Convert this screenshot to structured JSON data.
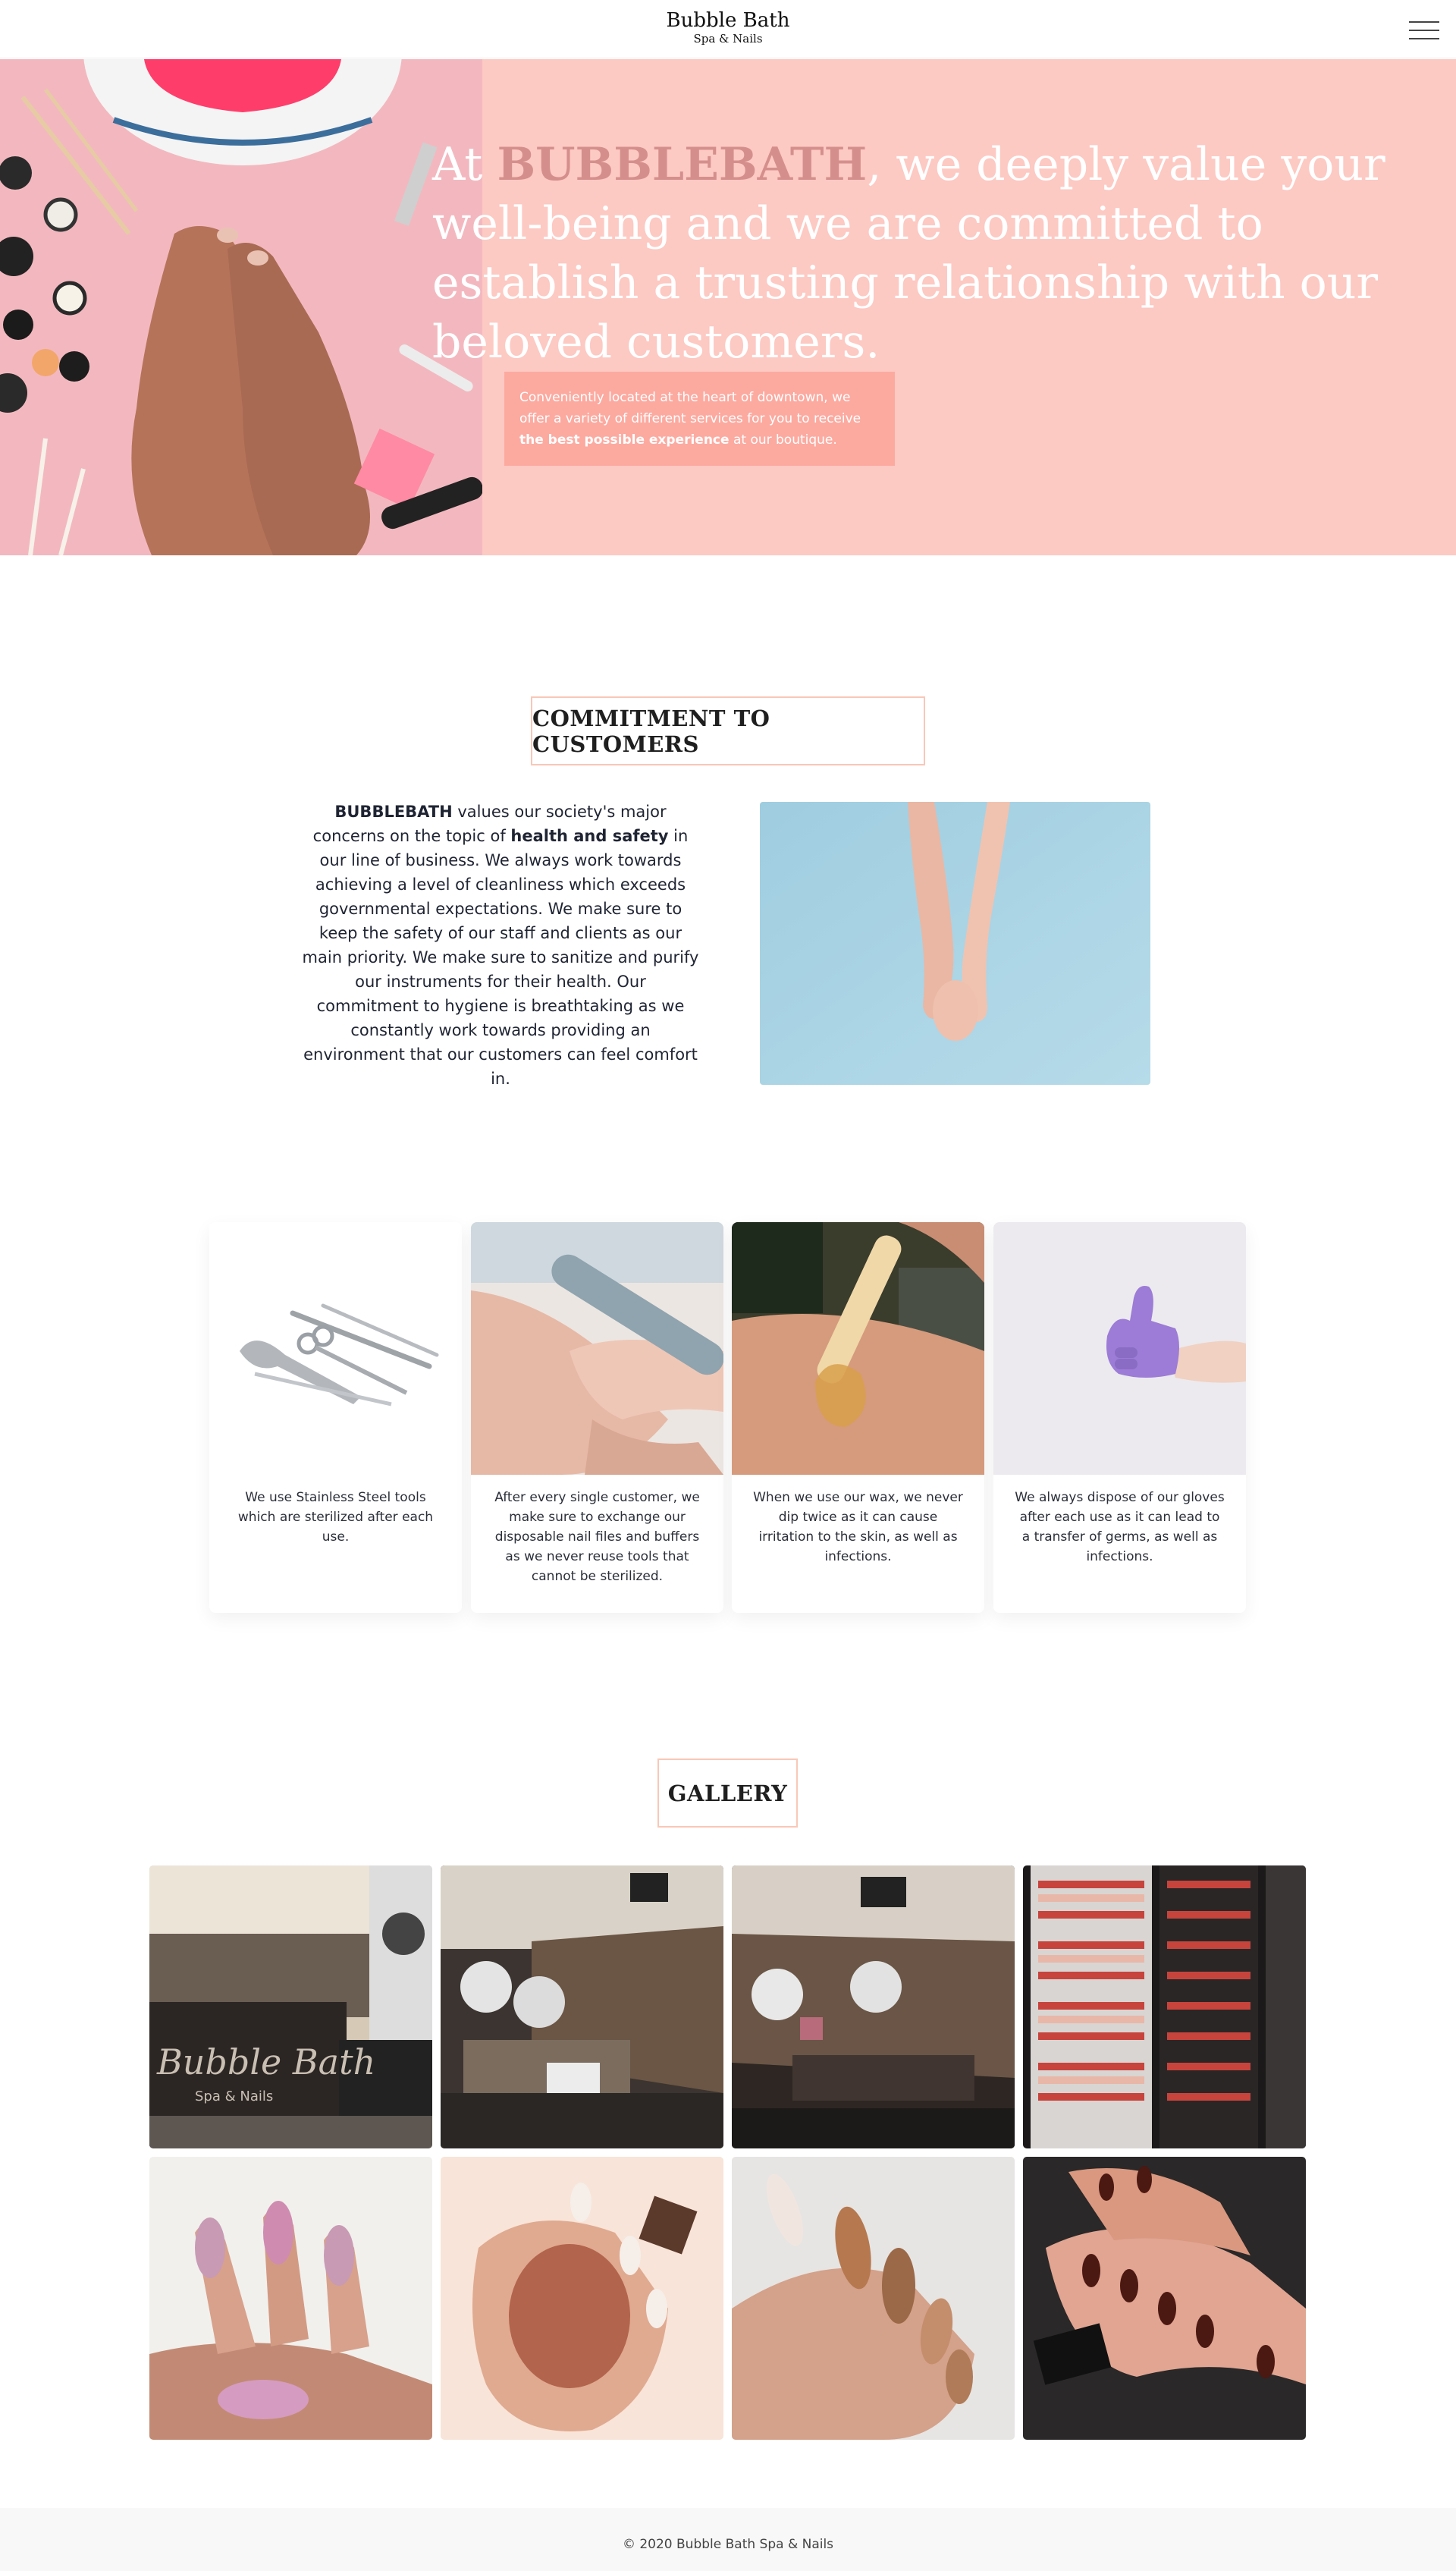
{
  "header": {
    "logo_main": "Bubble Bath",
    "logo_sub": "Spa & Nails",
    "menu_icon": "hamburger-menu-icon"
  },
  "hero": {
    "headline_prefix": "At ",
    "headline_brand": "BUBBLEBATH",
    "headline_rest": ", we deeply value your well-being and we are committed to establish a trusting relationship with our beloved customers.",
    "card_text": "Conveniently located at the heart of downtown, we offer a variety of different services for you to receive ",
    "card_bold": "the best possible experience",
    "card_end": " at our boutique.",
    "background_color": "#fdc9c3"
  },
  "commitment": {
    "title": "COMMITMENT TO CUSTOMERS",
    "brand": "BUBBLEBATH",
    "text_1": " values our society's major concerns on the topic of ",
    "bold_1": "health and safety",
    "text_2": " in our line of business. We always work towards achieving a level of cleanliness which exceeds governmental expectations. We make sure to keep the safety of our staff and clients as our main priority. We make sure to sanitize and purify our instruments for their health. Our commitment to hygiene is breathtaking as we constantly work towards providing an environment that our customers can feel comfort in."
  },
  "safety_cards": [
    {
      "text": "We use Stainless Steel tools which are sterilized after each use."
    },
    {
      "text": "After every single customer, we make sure to exchange our disposable nail files and buffers as we never reuse tools that cannot be sterilized."
    },
    {
      "text": "When we use our wax, we never dip twice as it can cause irritation to the skin, as well as infections."
    },
    {
      "text": "We always dispose of our gloves after each use as it can lead to a transfer of germs, as well as infections."
    }
  ],
  "gallery": {
    "title": "GALLERY",
    "sign_text": "Bubble Bath",
    "sign_sub": "Spa & Nails"
  },
  "footer": {
    "text": "© 2020 Bubble Bath Spa & Nails"
  }
}
